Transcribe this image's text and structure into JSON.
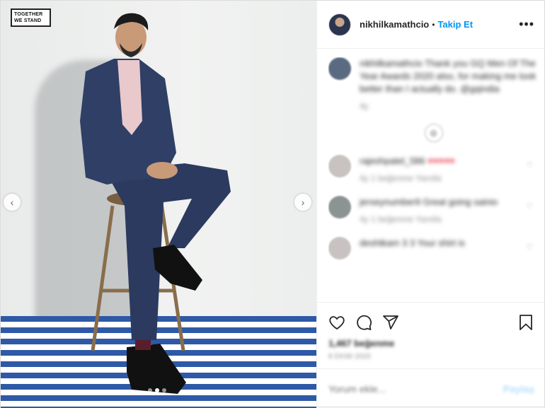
{
  "photo": {
    "logo_line1": "TOGETHER",
    "logo_line2": "WE STAND",
    "prev_arrow": "‹",
    "next_arrow": "›"
  },
  "header": {
    "username": "nikhilkamathcio",
    "separator": "•",
    "follow_label": "Takip Et",
    "more_label": "•••"
  },
  "comments": {
    "caption_text": "nikhilkamathcio Thank you GQ Men Of The Year Awards 2020 also, for making me look better than I actually do. @gqindia",
    "caption_meta": "4y",
    "load_more_icon": "⊕",
    "items": [
      {
        "text": "rajeshpatel_586",
        "hearts": "♥♥♥♥♥",
        "meta": "4y   1 beğenme   Yanıtla"
      },
      {
        "text": "jerseynumber9 Great going sainio",
        "hearts": "",
        "meta": "4y   1 beğenme   Yanıtla"
      },
      {
        "text": "deshtkam 3 3 Your shirt is",
        "hearts": "",
        "meta": ""
      }
    ]
  },
  "actions": {
    "likes": "1,467 beğenme",
    "date": "8 Ekim 2020"
  },
  "add_comment": {
    "placeholder": "Yorum ekle...",
    "post_label": "Paylaş"
  },
  "colors": {
    "accent": "#0095f6",
    "stripe": "#2e59a6",
    "heart": "#ed4956"
  }
}
